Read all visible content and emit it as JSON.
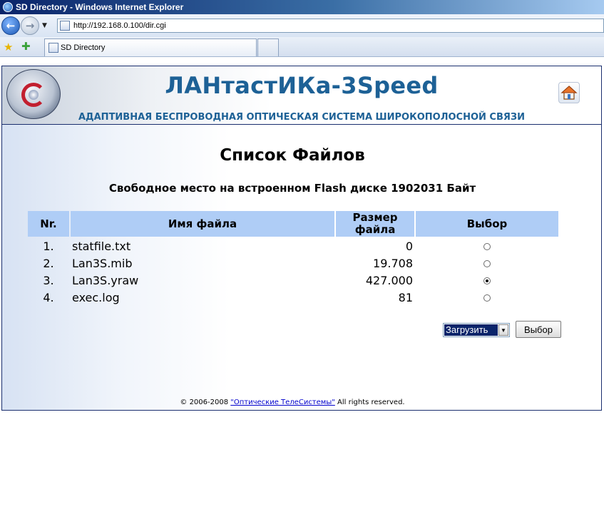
{
  "window": {
    "title": "SD Directory - Windows Internet Explorer"
  },
  "browser": {
    "url": "http://192.168.0.100/dir.cgi",
    "tab_title": "SD Directory"
  },
  "header": {
    "title": "ЛАНтастИКа-3Speed",
    "subtitle": "АДАПТИВНАЯ БЕСПРОВОДНАЯ ОПТИЧЕСКАЯ СИСТЕМА ШИРОКОПОЛОСНОЙ СВЯЗИ"
  },
  "main": {
    "heading": "Список Файлов",
    "free_space": "Свободное место на встроенном Flash диске 1902031 Байт",
    "table": {
      "headers": {
        "nr": "Nr.",
        "name": "Имя файла",
        "size_line1": "Размер",
        "size_line2": "файла",
        "select": "Выбор"
      },
      "rows": [
        {
          "nr": "1.",
          "name": "statfile.txt",
          "size": "0",
          "selected": false
        },
        {
          "nr": "2.",
          "name": "Lan3S.mib",
          "size": "19.708",
          "selected": false
        },
        {
          "nr": "3.",
          "name": "Lan3S.yraw",
          "size": "427.000",
          "selected": true
        },
        {
          "nr": "4.",
          "name": "exec.log",
          "size": "81",
          "selected": false
        }
      ]
    },
    "action_select_value": "Загрузить",
    "select_button": "Выбор"
  },
  "footer": {
    "prefix": "© 2006-2008",
    "link": "\"Оптические ТелеСистемы\"",
    "suffix": "All rights reserved."
  },
  "colors": {
    "accent": "#1d6196",
    "table_header": "#afcdf6",
    "link": "#0000cc"
  }
}
